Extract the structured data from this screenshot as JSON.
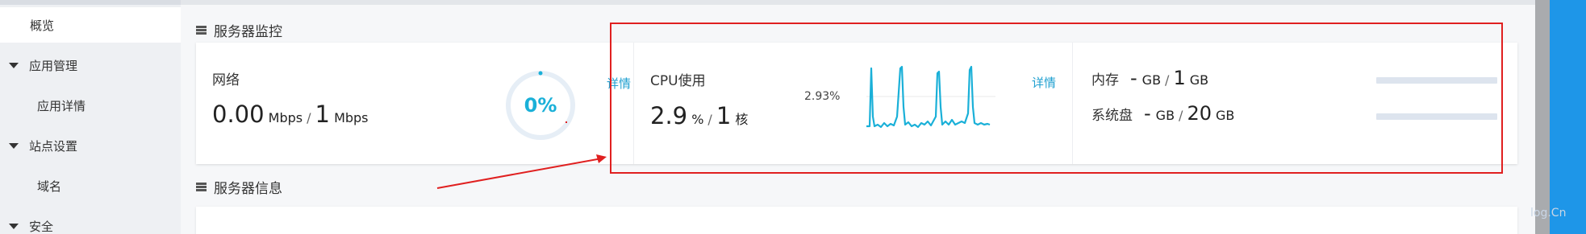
{
  "sidebar": {
    "overview": "概览",
    "app_management": "应用管理",
    "app_details": "应用详情",
    "site_settings": "站点设置",
    "domain": "域名",
    "security": "安全"
  },
  "server_monitor": {
    "title": "服务器监控",
    "network": {
      "label": "网络",
      "speed": "0.00",
      "speed_unit": "Mbps",
      "slash": "/",
      "bandwidth": "1",
      "bandwidth_unit": "Mbps",
      "gauge_percent": "0%",
      "gauge_fraction": 0.0,
      "detail_link": "详情"
    },
    "cpu": {
      "label": "CPU使用",
      "usage": "2.9",
      "usage_unit": "%",
      "slash": "/",
      "cores": "1",
      "cores_unit": "核",
      "chart_label": "2.93%",
      "detail_link": "详情"
    },
    "memory": {
      "label": "内存",
      "used": "-",
      "used_unit": "GB",
      "slash": "/",
      "total": "1",
      "total_unit": "GB"
    },
    "disk": {
      "label": "系统盘",
      "used": "-",
      "used_unit": "GB",
      "slash": "/",
      "total": "20",
      "total_unit": "GB"
    }
  },
  "server_info": {
    "title": "服务器信息"
  },
  "watermark": "log.Cn",
  "colors": {
    "accent": "#1ab0d8",
    "link": "#20a0d0",
    "annotation": "#e02020",
    "right_panel": "#1e96e8"
  }
}
